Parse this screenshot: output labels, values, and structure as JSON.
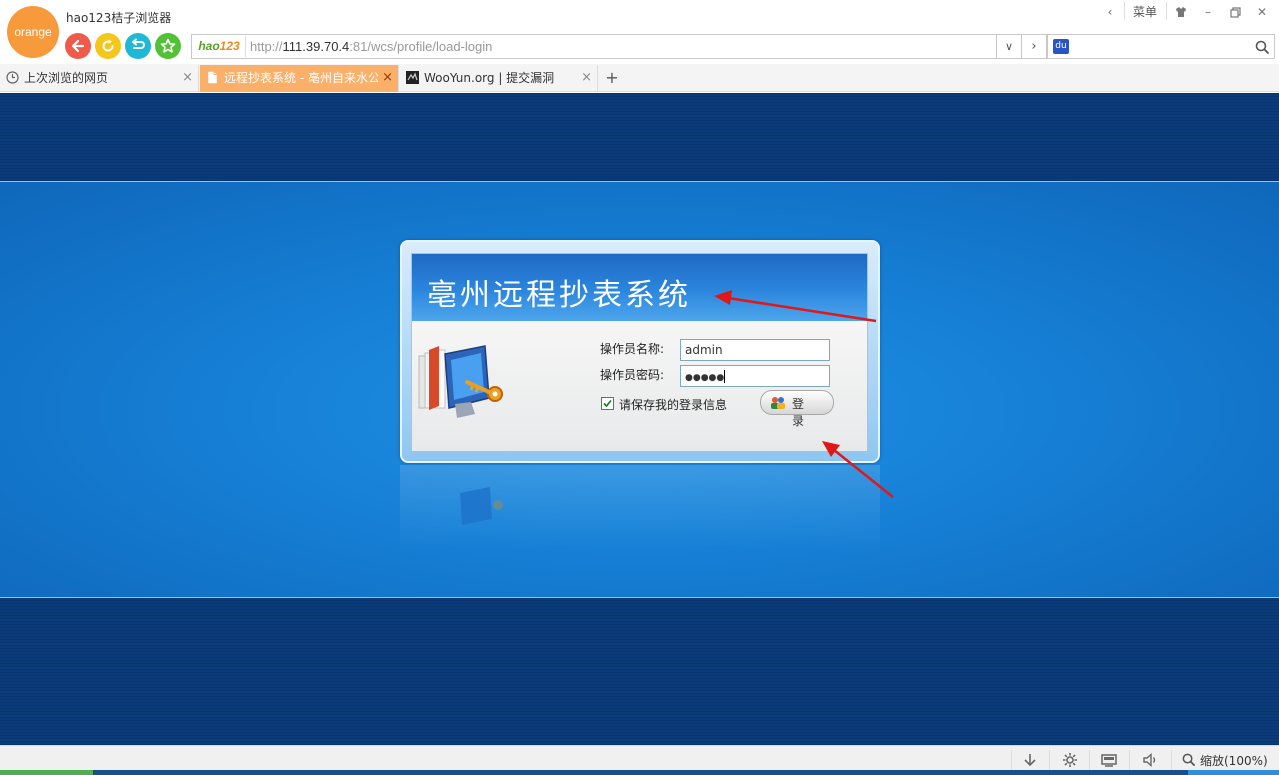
{
  "browser": {
    "logo_text": "orange",
    "title": "hao123桔子浏览器",
    "menu_label": "菜单"
  },
  "address": {
    "badge_left": "hao",
    "badge_right": "123",
    "url_scheme": "http://",
    "url_host": "111.39.70.4",
    "url_rest": ":81/wcs/profile/load-login"
  },
  "tabs": [
    {
      "label": "上次浏览的网页",
      "icon": "clock-icon",
      "active": false
    },
    {
      "label": "远程抄表系统 - 亳州自来水公",
      "icon": "page-icon",
      "active": true
    },
    {
      "label": "WooYun.org | 提交漏洞",
      "icon": "wooyun-icon",
      "active": false
    }
  ],
  "login": {
    "title": "亳州远程抄表系统",
    "user_label": "操作员名称:",
    "user_value": "admin",
    "pass_label": "操作员密码:",
    "pass_value": "●●●●●",
    "remember_label": "请保存我的登录信息",
    "remember_checked": true,
    "login_button": "登 录"
  },
  "status": {
    "zoom_label": "缩放(100%)"
  },
  "colors": {
    "accent_tab": "#fbb06a",
    "logo": "#f79a3c",
    "annotation_arrow": "#e01818"
  }
}
